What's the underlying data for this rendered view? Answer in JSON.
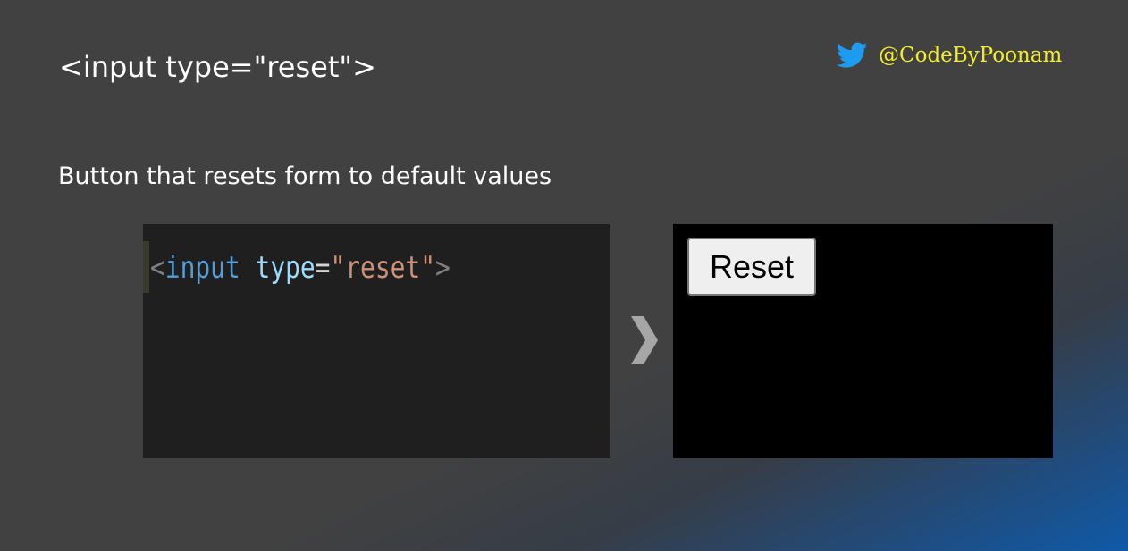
{
  "title": "<input type=\"reset\">",
  "subtitle": "Button that resets form to default values",
  "author": {
    "handle": "@CodeByPoonam",
    "icon": "twitter-bird-icon",
    "handle_color": "#f4ef22",
    "icon_color": "#1d9bf0"
  },
  "code": {
    "open_bracket": "<",
    "tag": "input",
    "attr": "type",
    "equals": "=",
    "value": "\"reset\"",
    "close_bracket": ">"
  },
  "arrow_icon": "chevron-right-icon",
  "preview": {
    "button_label": "Reset"
  }
}
